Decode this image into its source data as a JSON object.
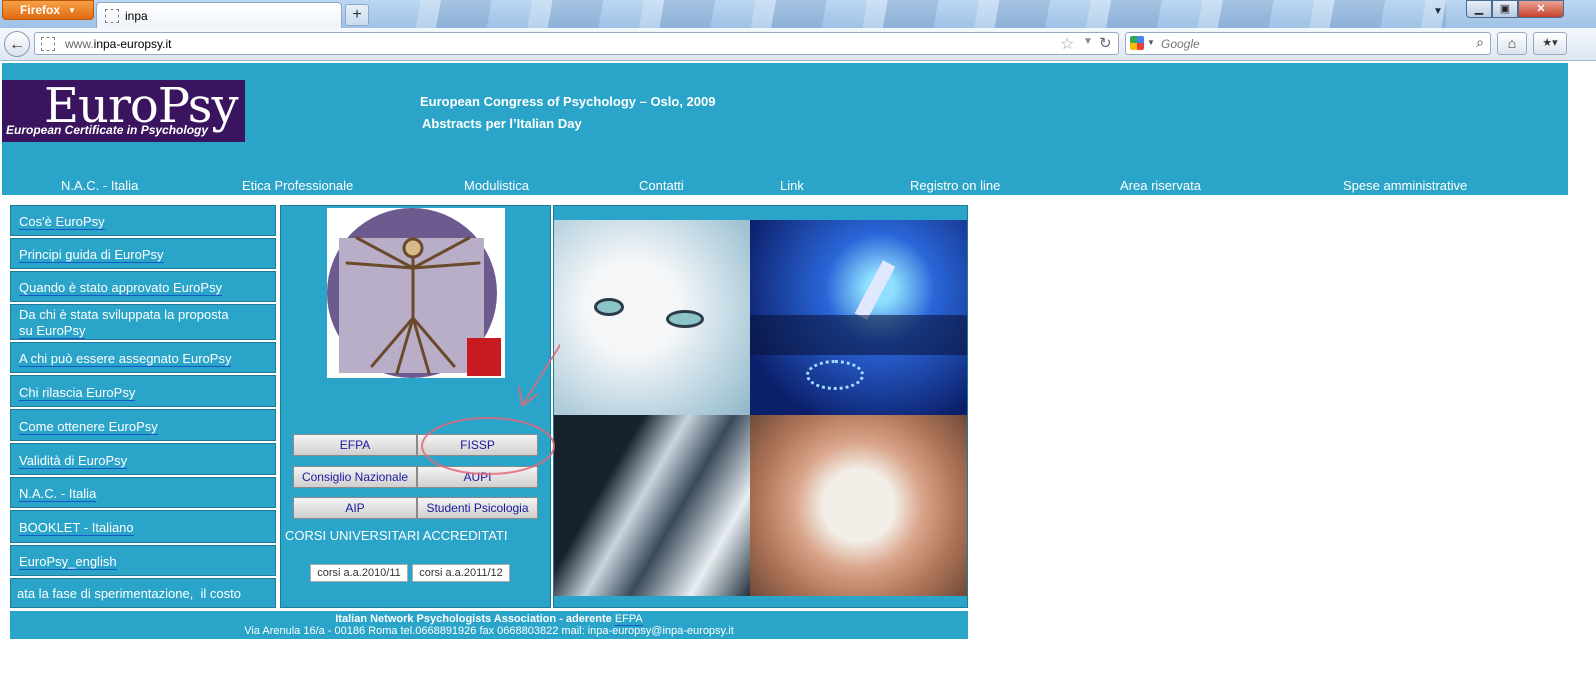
{
  "browser": {
    "app_button": "Firefox",
    "tab_title": "inpa",
    "new_tab": "+",
    "url_prefix": "www.",
    "url_domain": "inpa-europsy.it",
    "search_placeholder": "Google"
  },
  "header": {
    "logo_text": "EuroPsy",
    "logo_subtitle": "European Certificate in Psychology",
    "title": "European Congress of Psychology – Oslo, 2009",
    "subtitle": "Abstracts per l’Italian Day"
  },
  "topnav": [
    "N.A.C. - Italia",
    "Etica Professionale",
    "Modulistica",
    "Contatti",
    "Link",
    "Registro on line",
    "Area riservata",
    "Spese amministrative"
  ],
  "sidebar": {
    "items": [
      {
        "label": "Cos'è EuroPsy"
      },
      {
        "label": "Principi guida di EuroPsy"
      },
      {
        "label": "Quando è stato approvato EuroPsy"
      },
      {
        "label": "Da chi è stata sviluppata la proposta",
        "label2": "su EuroPsy"
      },
      {
        "label": "A chi può essere assegnato EuroPsy"
      },
      {
        "label": "Chi rilascia EuroPsy"
      },
      {
        "label": "Come ottenere EuroPsy"
      },
      {
        "label": "Validità di EuroPsy"
      },
      {
        "label": "N.A.C. - Italia"
      },
      {
        "label": "BOOKLET - Italiano"
      },
      {
        "label": "EuroPsy_english"
      },
      {
        "label": "ata la fase di sperimentazione,  il costo"
      }
    ]
  },
  "middle": {
    "buttons": [
      "EFPA",
      "FISSP",
      "Consiglio Nazionale",
      "AUPI",
      "AIP",
      "Studenti Psicologia"
    ],
    "corsi_title": "CORSI UNIVERSITARI ACCREDITATI",
    "corsi_links": [
      "corsi a.a.2010/11",
      "corsi a.a.2011/12"
    ]
  },
  "footer": {
    "line1_prefix": "Italian Network Psychologists Association - aderente ",
    "line1_link": "EFPA",
    "line2": "Via Arenula 16/a - 00186 Roma tel.0668891926 fax 0668803822 mail: inpa-europsy@inpa-europsy.it"
  },
  "colors": {
    "page_bg": "#2aa5c9",
    "logo_bg": "#3a145e",
    "annotation": "#e06a78"
  }
}
